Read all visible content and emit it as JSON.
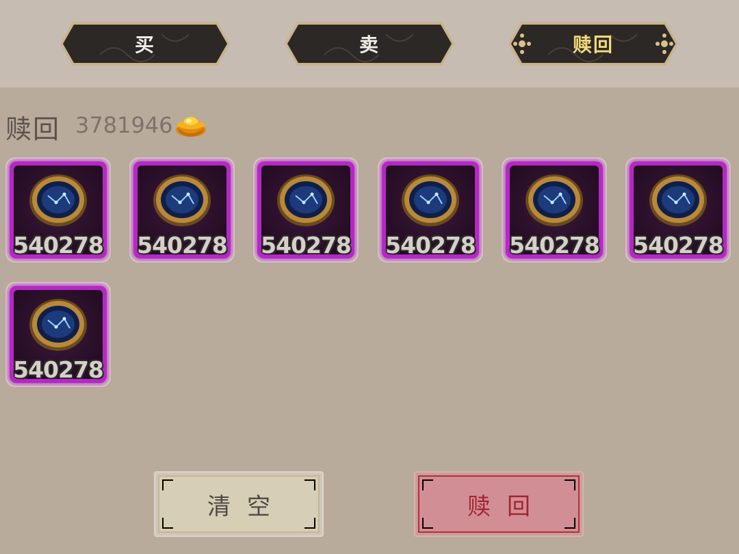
{
  "tabs": [
    {
      "label": "买",
      "active": false
    },
    {
      "label": "卖",
      "active": false
    },
    {
      "label": "赎回",
      "active": true
    }
  ],
  "section": {
    "title": "赎回",
    "balance": "3781946",
    "currency_icon": "gold-ingot-icon"
  },
  "items": [
    {
      "count": "540278",
      "icon": "compass-icon"
    },
    {
      "count": "540278",
      "icon": "compass-icon"
    },
    {
      "count": "540278",
      "icon": "compass-icon"
    },
    {
      "count": "540278",
      "icon": "compass-icon"
    },
    {
      "count": "540278",
      "icon": "compass-icon"
    },
    {
      "count": "540278",
      "icon": "compass-icon"
    },
    {
      "count": "540278",
      "icon": "compass-icon"
    }
  ],
  "buttons": {
    "clear_label": "清空",
    "redeem_label": "赎回"
  },
  "colors": {
    "background": "#b8ab9c",
    "tab_bg": "#2a2624",
    "tab_border": "#c8b48a",
    "active_tab_text": "#f3d97a",
    "item_frame": "#b429c4",
    "redeem_button": "#d18f95"
  }
}
